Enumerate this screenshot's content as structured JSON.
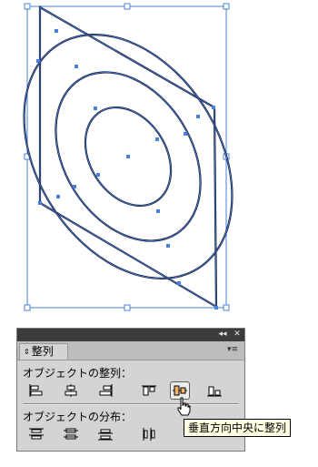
{
  "panel": {
    "tab_label": "整列",
    "tab_arrows": "⇕",
    "collapse_glyph": "◂◂",
    "close_glyph": "✕",
    "menu_glyph": "▾≡",
    "align_section_label": "オブジェクトの整列：",
    "distribute_section_label": "オブジェクトの分布：",
    "align_buttons": [
      {
        "icon": "horizontal-align-left-icon"
      },
      {
        "icon": "horizontal-align-center-icon"
      },
      {
        "icon": "horizontal-align-right-icon"
      },
      {
        "icon": "vertical-align-top-icon"
      },
      {
        "icon": "vertical-align-center-icon",
        "state": "hovered"
      },
      {
        "icon": "vertical-align-bottom-icon"
      }
    ],
    "distribute_buttons": [
      {
        "icon": "vertical-distribute-top-icon"
      },
      {
        "icon": "vertical-distribute-center-icon"
      },
      {
        "icon": "vertical-distribute-bottom-icon"
      },
      {
        "icon": "horizontal-distribute-left-icon"
      }
    ]
  },
  "tooltip": {
    "text": "垂直方向中央に整列"
  },
  "colors": {
    "selection": "#4a7fd9",
    "artwork_stroke": "#1a1f3a",
    "panel_bg": "#d4d4d4",
    "titlebar": "#3c3c3c",
    "tooltip_bg": "#ffffe1"
  }
}
